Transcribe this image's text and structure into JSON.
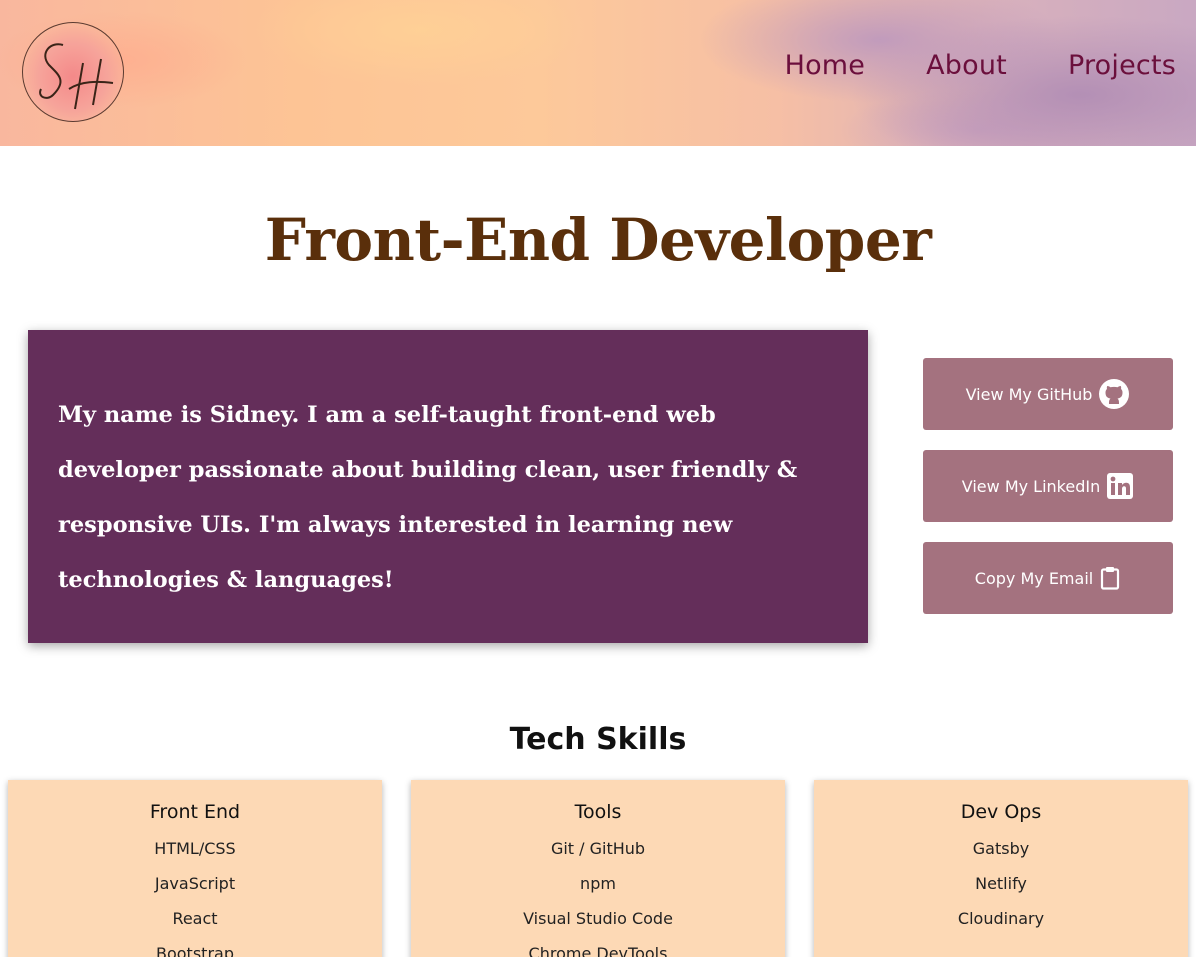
{
  "header": {
    "logo_text": "SH",
    "nav": [
      {
        "label": "Home"
      },
      {
        "label": "About"
      },
      {
        "label": "Projects"
      }
    ]
  },
  "main": {
    "title": "Front-End Developer",
    "bio": "My name is Sidney. I am a self-taught front-end web developer passionate about building clean, user friendly & responsive UIs. I'm always interested in learning new technologies & languages!"
  },
  "actions": [
    {
      "label": "View My GitHub",
      "icon": "github-icon"
    },
    {
      "label": "View My LinkedIn",
      "icon": "linkedin-icon"
    },
    {
      "label": "Copy My Email",
      "icon": "clipboard-icon"
    }
  ],
  "skills": {
    "heading": "Tech Skills",
    "groups": [
      {
        "title": "Front End",
        "items": [
          "HTML/CSS",
          "JavaScript",
          "React",
          "Bootstrap"
        ]
      },
      {
        "title": "Tools",
        "items": [
          "Git / GitHub",
          "npm",
          "Visual Studio Code",
          "Chrome DevTools"
        ]
      },
      {
        "title": "Dev Ops",
        "items": [
          "Gatsby",
          "Netlify",
          "Cloudinary"
        ]
      }
    ]
  },
  "colors": {
    "nav_text": "#6b0f3c",
    "title": "#5a2f0b",
    "bio_bg": "#642e5a",
    "button_bg": "#a4727f",
    "card_bg": "#fdd9b5"
  }
}
